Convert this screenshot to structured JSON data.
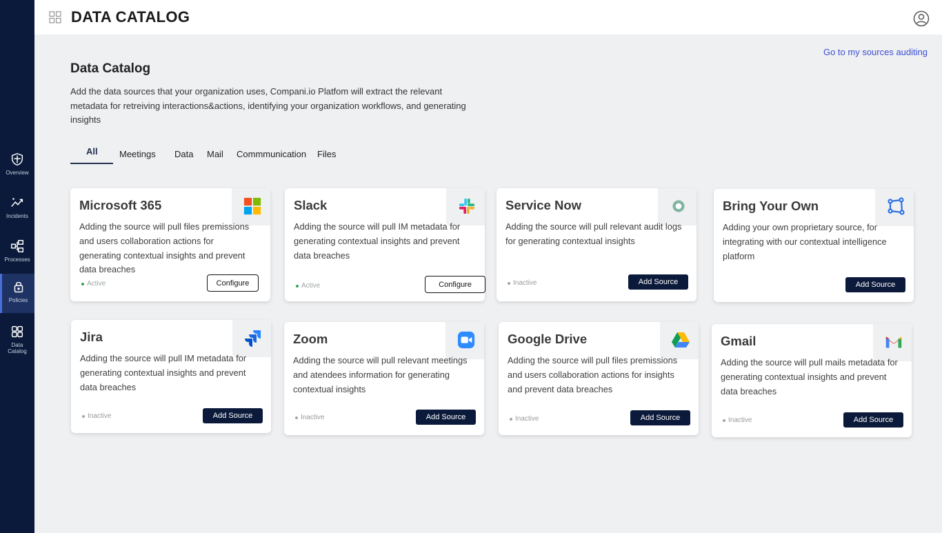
{
  "sidebar": {
    "items": [
      {
        "label": "Overview",
        "icon": "shield-icon"
      },
      {
        "label": "Incidents",
        "icon": "trend-icon"
      },
      {
        "label": "Processes",
        "icon": "flow-icon"
      },
      {
        "label": "Policies",
        "icon": "lock-icon"
      },
      {
        "label": "Data\nCatalog",
        "icon": "grid-icon"
      }
    ],
    "active": "Policies"
  },
  "header": {
    "title": "DATA CATALOG"
  },
  "links": {
    "audit": "Go to my sources auditing"
  },
  "main": {
    "title": "Data Catalog",
    "description": "Add the data sources that your organization uses, Compani.io Platfom will extract the relevant metadata for retreiving interactions&actions, identifying your organization workflows, and generating insights"
  },
  "tabs": [
    "All",
    "Meetings",
    "Data",
    "Mail",
    "Commmunication",
    "Files"
  ],
  "cards": [
    {
      "title": "Microsoft 365",
      "description": "Adding the source will pull files premissions and users collaboration actions for generating contextual insights and prevent data breaches",
      "status": "Active",
      "button": "Configure",
      "icon": "microsoft-logo-icon"
    },
    {
      "title": "Slack",
      "description": "Adding the source will pull IM metadata for generating contextual insights and prevent data breaches",
      "status": "Active",
      "button": "Configure",
      "icon": "slack-logo-icon"
    },
    {
      "title": "Service Now",
      "description": "Adding the source will pull relevant audit logs for generating contextual insights",
      "status": "Inactive",
      "button": "Add Source",
      "icon": "servicenow-logo-icon"
    },
    {
      "title": "Bring Your Own",
      "description": "Adding your own proprietary source, for integrating with our contextual intelligence platform",
      "button": "Add Source",
      "icon": "custom-source-icon"
    },
    {
      "title": "Jira",
      "description": "Adding the source will pull IM metadata for generating contextual insights and prevent data breaches",
      "status": "Inactive",
      "button": "Add Source",
      "icon": "jira-logo-icon"
    },
    {
      "title": "Zoom",
      "description": "Adding the source will pull relevant meetings and atendees information for generating contextual insights",
      "status": "Inactive",
      "button": "Add Source",
      "icon": "zoom-logo-icon"
    },
    {
      "title": "Google Drive",
      "description": "Adding the source will pull files premissions and users collaboration actions for  insights and prevent data breaches",
      "status": "Inactive",
      "button": "Add Source",
      "icon": "google-drive-logo-icon"
    },
    {
      "title": "Gmail",
      "description": "Adding the source will pull mails metadata for generating contextual insights and prevent data breaches",
      "status": "Inactive",
      "button": "Add Source",
      "icon": "gmail-logo-icon"
    }
  ],
  "colors": {
    "sidebar": "#0b1a3a",
    "accent": "#3b4fd1",
    "active_status": "#2fa35a"
  }
}
